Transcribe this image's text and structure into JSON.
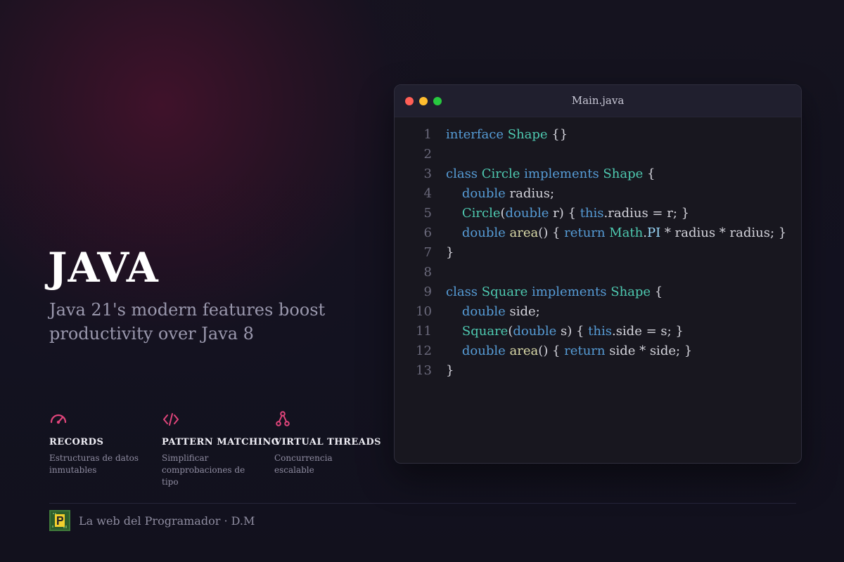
{
  "hero": {
    "title": "JAVA",
    "subtitle": "Java 21's modern features boost productivity over Java 8"
  },
  "features": [
    {
      "icon": "gauge-icon",
      "name": "RECORDS",
      "desc": "Estructuras de datos inmutables"
    },
    {
      "icon": "code-icon",
      "name": "PATTERN MATCHING",
      "desc": "Simplificar comprobaciones de tipo"
    },
    {
      "icon": "fork-icon",
      "name": "VIRTUAL THREADS",
      "desc": "Concurrencia escalable"
    }
  ],
  "footer": {
    "text": "La web del Programador · D.M"
  },
  "editor": {
    "filename": "Main.java",
    "lines": [
      {
        "n": "1",
        "tokens": [
          [
            "kw",
            "interface"
          ],
          [
            "plain",
            " "
          ],
          [
            "type",
            "Shape"
          ],
          [
            "plain",
            " {}"
          ]
        ]
      },
      {
        "n": "2",
        "tokens": []
      },
      {
        "n": "3",
        "tokens": [
          [
            "kw",
            "class"
          ],
          [
            "plain",
            " "
          ],
          [
            "type",
            "Circle"
          ],
          [
            "plain",
            " "
          ],
          [
            "kw",
            "implements"
          ],
          [
            "plain",
            " "
          ],
          [
            "type",
            "Shape"
          ],
          [
            "plain",
            " {"
          ]
        ]
      },
      {
        "n": "4",
        "tokens": [
          [
            "plain",
            "    "
          ],
          [
            "kw",
            "double"
          ],
          [
            "plain",
            " radius;"
          ]
        ]
      },
      {
        "n": "5",
        "tokens": [
          [
            "plain",
            "    "
          ],
          [
            "type",
            "Circle"
          ],
          [
            "plain",
            "("
          ],
          [
            "kw",
            "double"
          ],
          [
            "plain",
            " r) { "
          ],
          [
            "kw",
            "this"
          ],
          [
            "plain",
            ".radius = r; }"
          ]
        ]
      },
      {
        "n": "6",
        "tokens": [
          [
            "plain",
            "    "
          ],
          [
            "kw",
            "double"
          ],
          [
            "plain",
            " "
          ],
          [
            "fn",
            "area"
          ],
          [
            "plain",
            "() { "
          ],
          [
            "kw",
            "return"
          ],
          [
            "plain",
            " "
          ],
          [
            "type",
            "Math"
          ],
          [
            "plain",
            "."
          ],
          [
            "prop",
            "PI"
          ],
          [
            "plain",
            " * radius * radius; }"
          ]
        ]
      },
      {
        "n": "7",
        "tokens": [
          [
            "plain",
            "}"
          ]
        ]
      },
      {
        "n": "8",
        "tokens": []
      },
      {
        "n": "9",
        "tokens": [
          [
            "kw",
            "class"
          ],
          [
            "plain",
            " "
          ],
          [
            "type",
            "Square"
          ],
          [
            "plain",
            " "
          ],
          [
            "kw",
            "implements"
          ],
          [
            "plain",
            " "
          ],
          [
            "type",
            "Shape"
          ],
          [
            "plain",
            " {"
          ]
        ]
      },
      {
        "n": "10",
        "tokens": [
          [
            "plain",
            "    "
          ],
          [
            "kw",
            "double"
          ],
          [
            "plain",
            " side;"
          ]
        ]
      },
      {
        "n": "11",
        "tokens": [
          [
            "plain",
            "    "
          ],
          [
            "type",
            "Square"
          ],
          [
            "plain",
            "("
          ],
          [
            "kw",
            "double"
          ],
          [
            "plain",
            " s) { "
          ],
          [
            "kw",
            "this"
          ],
          [
            "plain",
            ".side = s; }"
          ]
        ]
      },
      {
        "n": "12",
        "tokens": [
          [
            "plain",
            "    "
          ],
          [
            "kw",
            "double"
          ],
          [
            "plain",
            " "
          ],
          [
            "fn",
            "area"
          ],
          [
            "plain",
            "() { "
          ],
          [
            "kw",
            "return"
          ],
          [
            "plain",
            " side * side; }"
          ]
        ]
      },
      {
        "n": "13",
        "tokens": [
          [
            "plain",
            "}"
          ]
        ]
      }
    ]
  },
  "colors": {
    "accent": "#e0457b",
    "keyword": "#569cd6",
    "type": "#4ec9b0",
    "function": "#dcdcaa",
    "property": "#9cdcfe"
  }
}
